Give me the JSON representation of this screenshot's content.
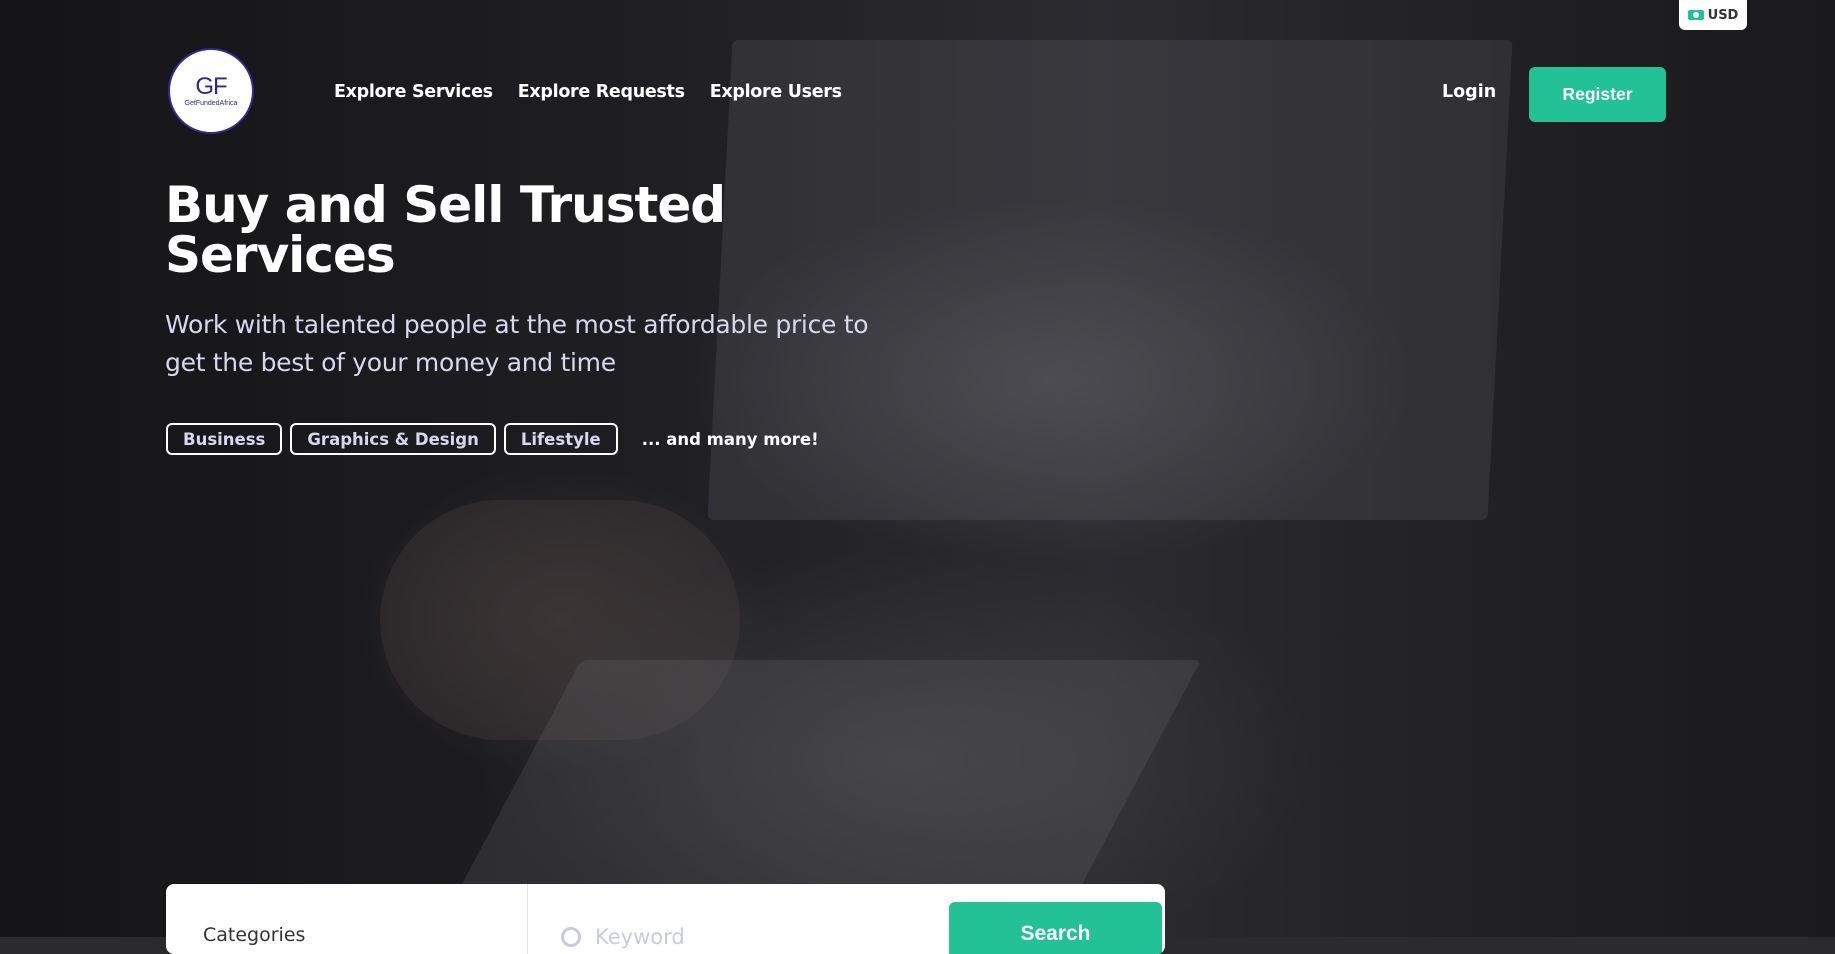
{
  "header": {
    "currency": "USD",
    "logo": {
      "mark": "GF",
      "subtitle": "GetFundedAfrica"
    },
    "nav": [
      "Explore Services",
      "Explore Requests",
      "Explore Users"
    ],
    "login": "Login",
    "register": "Register"
  },
  "hero": {
    "title": "Buy and Sell Trusted Services",
    "subtitle": "Work with talented people at the most affordable price to get the best of your money and time",
    "tags": [
      "Business",
      "Graphics & Design",
      "Lifestyle"
    ],
    "more": "... and many more!"
  },
  "search": {
    "category_label": "Categories",
    "keyword_placeholder": "Keyword",
    "button": "Search"
  },
  "colors": {
    "accent": "#23c196",
    "logo_blue": "#2a2a90"
  }
}
